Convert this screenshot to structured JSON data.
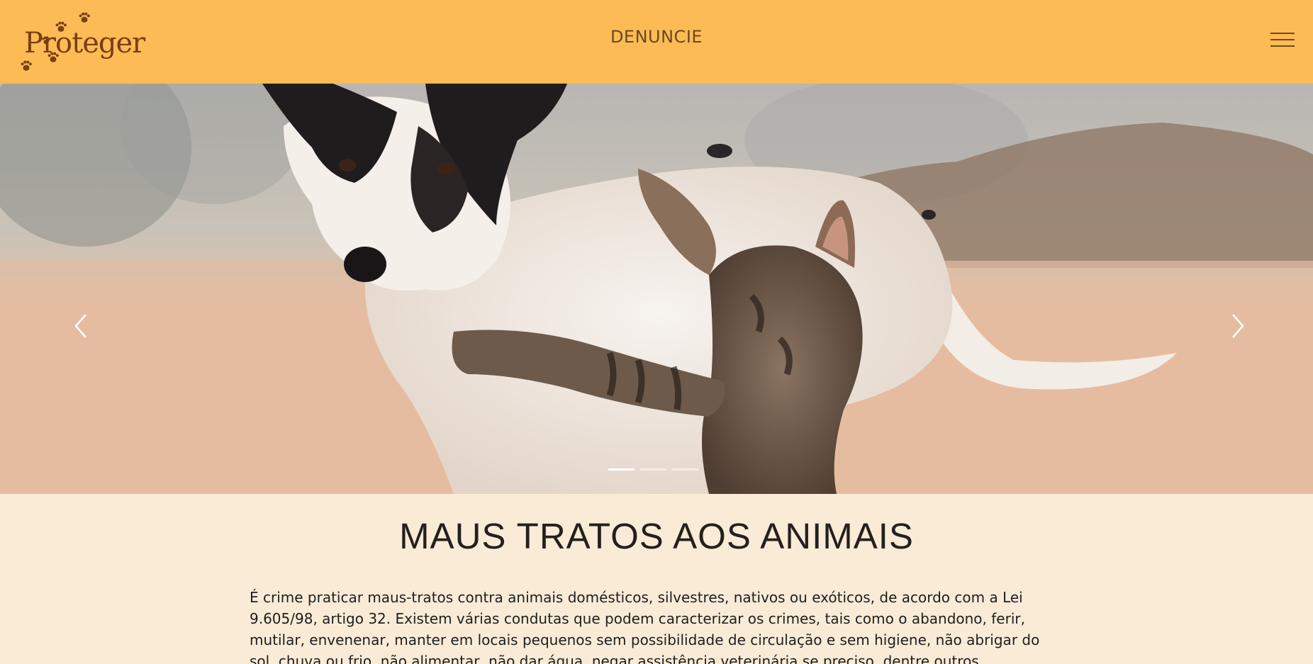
{
  "header": {
    "logo_text": "Proteger",
    "nav_link": "DENUNCIE",
    "menu_icon": "hamburger-menu-icon",
    "colors": {
      "background": "#fdbb55",
      "text": "#6b4a1c",
      "logo": "#7a3e12"
    }
  },
  "carousel": {
    "image": "dog-and-cat-photo",
    "prev_icon": "chevron-left-icon",
    "next_icon": "chevron-right-icon",
    "slide_count": 3,
    "active_slide": 1
  },
  "content": {
    "title": "MAUS TRATOS AOS ANIMAIS",
    "paragraph": "É crime praticar maus-tratos contra animais domésticos, silvestres, nativos ou exóticos, de acordo com a Lei 9.605/98, artigo 32. Existem várias condutas que podem caracterizar os crimes, tais como o abandono, ferir, mutilar, envenenar, manter em locais pequenos sem possibilidade de circulação e sem higiene, não abrigar do sol, chuva ou frio, não alimentar, não dar água, negar assistência veterinária se preciso, dentre outros.",
    "background": "#faebd7"
  }
}
